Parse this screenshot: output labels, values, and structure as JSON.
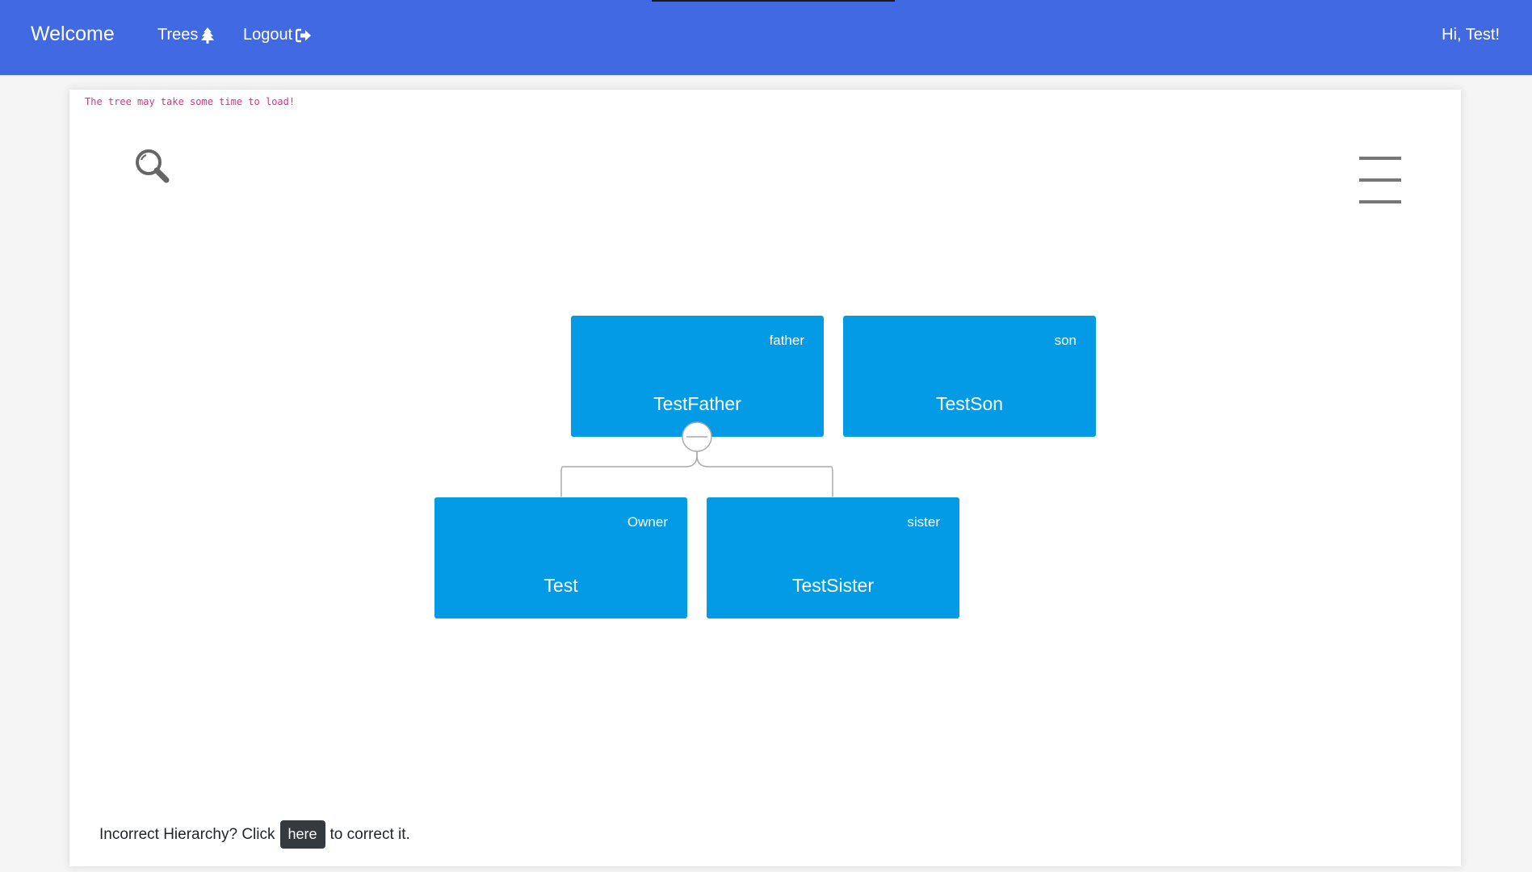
{
  "navbar": {
    "brand": "Welcome",
    "trees_label": "Trees",
    "logout_label": "Logout",
    "greeting": "Hi, Test!",
    "background_color": "#4169e1"
  },
  "content": {
    "load_note": "The tree may take some time to load!",
    "search_icon": "search-icon",
    "menu_icon": "hamburger-menu-icon"
  },
  "tree": {
    "node_color": "#039be5",
    "nodes": [
      {
        "name": "TestFather",
        "role": "father"
      },
      {
        "name": "TestSon",
        "role": "son"
      },
      {
        "name": "Test",
        "role": "Owner"
      },
      {
        "name": "TestSister",
        "role": "sister"
      }
    ]
  },
  "footer": {
    "prefix": "Incorrect Hierarchy? Click",
    "link_label": "here",
    "suffix": "to correct it."
  }
}
